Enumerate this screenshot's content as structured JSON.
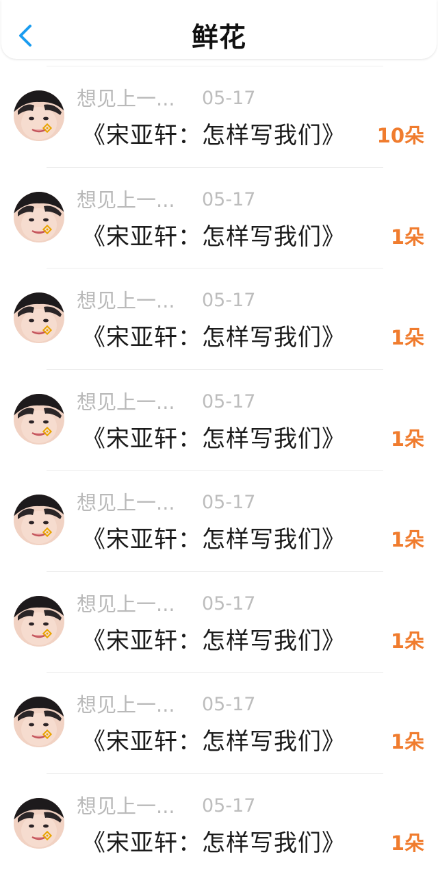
{
  "header": {
    "title": "鲜花",
    "back_icon": "chevron-left-icon"
  },
  "colors": {
    "accent": "#1a9cf0",
    "count": "#f07c2e",
    "meta": "#bbbbbb",
    "text": "#1b1b1b"
  },
  "items": [
    {
      "name": "想见上一...",
      "date": "05-17",
      "book": "《宋亚轩：怎样写我们》",
      "count": "10朵"
    },
    {
      "name": "想见上一...",
      "date": "05-17",
      "book": "《宋亚轩：怎样写我们》",
      "count": "1朵"
    },
    {
      "name": "想见上一...",
      "date": "05-17",
      "book": "《宋亚轩：怎样写我们》",
      "count": "1朵"
    },
    {
      "name": "想见上一...",
      "date": "05-17",
      "book": "《宋亚轩：怎样写我们》",
      "count": "1朵"
    },
    {
      "name": "想见上一...",
      "date": "05-17",
      "book": "《宋亚轩：怎样写我们》",
      "count": "1朵"
    },
    {
      "name": "想见上一...",
      "date": "05-17",
      "book": "《宋亚轩：怎样写我们》",
      "count": "1朵"
    },
    {
      "name": "想见上一...",
      "date": "05-17",
      "book": "《宋亚轩：怎样写我们》",
      "count": "1朵"
    },
    {
      "name": "想见上一...",
      "date": "05-17",
      "book": "《宋亚轩：怎样写我们》",
      "count": "1朵"
    }
  ]
}
